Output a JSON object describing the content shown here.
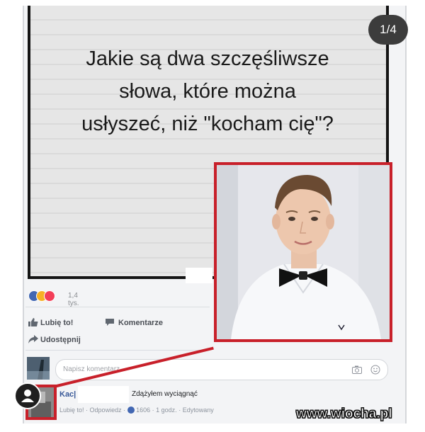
{
  "gallery": {
    "counter": "1/4"
  },
  "meme": {
    "line1": "Jakie są dwa szczęśliwsze",
    "line2": "słowa, które można",
    "line3": "usłyszeć, niż \"kocham cię\"?"
  },
  "reactions": {
    "count": "1,4 tys."
  },
  "actions": {
    "like": "Lubię to!",
    "comment": "Komentarze",
    "share": "Udostępnij"
  },
  "comment_input": {
    "placeholder": "Napisz komentarz..."
  },
  "comment": {
    "author": "Kac|",
    "text": "Zdążyłem wyciągnąć",
    "meta": {
      "like": "Lubię to!",
      "reply": "Odpowiedz",
      "likes": "1606",
      "time": "1 godz.",
      "edited": "Edytowany"
    }
  },
  "watermark": "www.wiocha.pl",
  "colors": {
    "highlight": "#c8202a",
    "facebook_blue": "#4267b2"
  }
}
